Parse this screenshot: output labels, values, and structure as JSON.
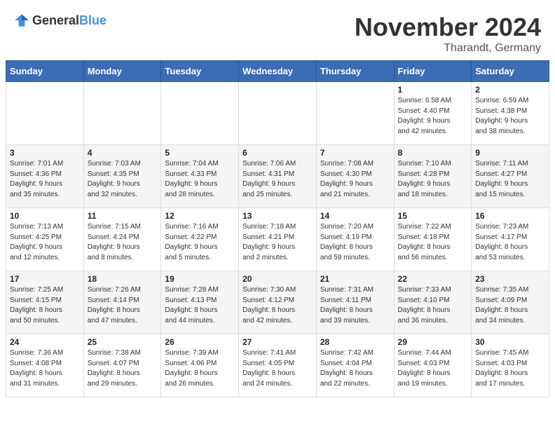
{
  "header": {
    "logo_general": "General",
    "logo_blue": "Blue",
    "month": "November 2024",
    "location": "Tharandt, Germany"
  },
  "weekdays": [
    "Sunday",
    "Monday",
    "Tuesday",
    "Wednesday",
    "Thursday",
    "Friday",
    "Saturday"
  ],
  "weeks": [
    [
      {
        "day": "",
        "info": ""
      },
      {
        "day": "",
        "info": ""
      },
      {
        "day": "",
        "info": ""
      },
      {
        "day": "",
        "info": ""
      },
      {
        "day": "",
        "info": ""
      },
      {
        "day": "1",
        "info": "Sunrise: 6:58 AM\nSunset: 4:40 PM\nDaylight: 9 hours\nand 42 minutes."
      },
      {
        "day": "2",
        "info": "Sunrise: 6:59 AM\nSunset: 4:38 PM\nDaylight: 9 hours\nand 38 minutes."
      }
    ],
    [
      {
        "day": "3",
        "info": "Sunrise: 7:01 AM\nSunset: 4:36 PM\nDaylight: 9 hours\nand 35 minutes."
      },
      {
        "day": "4",
        "info": "Sunrise: 7:03 AM\nSunset: 4:35 PM\nDaylight: 9 hours\nand 32 minutes."
      },
      {
        "day": "5",
        "info": "Sunrise: 7:04 AM\nSunset: 4:33 PM\nDaylight: 9 hours\nand 28 minutes."
      },
      {
        "day": "6",
        "info": "Sunrise: 7:06 AM\nSunset: 4:31 PM\nDaylight: 9 hours\nand 25 minutes."
      },
      {
        "day": "7",
        "info": "Sunrise: 7:08 AM\nSunset: 4:30 PM\nDaylight: 9 hours\nand 21 minutes."
      },
      {
        "day": "8",
        "info": "Sunrise: 7:10 AM\nSunset: 4:28 PM\nDaylight: 9 hours\nand 18 minutes."
      },
      {
        "day": "9",
        "info": "Sunrise: 7:11 AM\nSunset: 4:27 PM\nDaylight: 9 hours\nand 15 minutes."
      }
    ],
    [
      {
        "day": "10",
        "info": "Sunrise: 7:13 AM\nSunset: 4:25 PM\nDaylight: 9 hours\nand 12 minutes."
      },
      {
        "day": "11",
        "info": "Sunrise: 7:15 AM\nSunset: 4:24 PM\nDaylight: 9 hours\nand 8 minutes."
      },
      {
        "day": "12",
        "info": "Sunrise: 7:16 AM\nSunset: 4:22 PM\nDaylight: 9 hours\nand 5 minutes."
      },
      {
        "day": "13",
        "info": "Sunrise: 7:18 AM\nSunset: 4:21 PM\nDaylight: 9 hours\nand 2 minutes."
      },
      {
        "day": "14",
        "info": "Sunrise: 7:20 AM\nSunset: 4:19 PM\nDaylight: 8 hours\nand 59 minutes."
      },
      {
        "day": "15",
        "info": "Sunrise: 7:22 AM\nSunset: 4:18 PM\nDaylight: 8 hours\nand 56 minutes."
      },
      {
        "day": "16",
        "info": "Sunrise: 7:23 AM\nSunset: 4:17 PM\nDaylight: 8 hours\nand 53 minutes."
      }
    ],
    [
      {
        "day": "17",
        "info": "Sunrise: 7:25 AM\nSunset: 4:15 PM\nDaylight: 8 hours\nand 50 minutes."
      },
      {
        "day": "18",
        "info": "Sunrise: 7:26 AM\nSunset: 4:14 PM\nDaylight: 8 hours\nand 47 minutes."
      },
      {
        "day": "19",
        "info": "Sunrise: 7:28 AM\nSunset: 4:13 PM\nDaylight: 8 hours\nand 44 minutes."
      },
      {
        "day": "20",
        "info": "Sunrise: 7:30 AM\nSunset: 4:12 PM\nDaylight: 8 hours\nand 42 minutes."
      },
      {
        "day": "21",
        "info": "Sunrise: 7:31 AM\nSunset: 4:11 PM\nDaylight: 8 hours\nand 39 minutes."
      },
      {
        "day": "22",
        "info": "Sunrise: 7:33 AM\nSunset: 4:10 PM\nDaylight: 8 hours\nand 36 minutes."
      },
      {
        "day": "23",
        "info": "Sunrise: 7:35 AM\nSunset: 4:09 PM\nDaylight: 8 hours\nand 34 minutes."
      }
    ],
    [
      {
        "day": "24",
        "info": "Sunrise: 7:36 AM\nSunset: 4:08 PM\nDaylight: 8 hours\nand 31 minutes."
      },
      {
        "day": "25",
        "info": "Sunrise: 7:38 AM\nSunset: 4:07 PM\nDaylight: 8 hours\nand 29 minutes."
      },
      {
        "day": "26",
        "info": "Sunrise: 7:39 AM\nSunset: 4:06 PM\nDaylight: 8 hours\nand 26 minutes."
      },
      {
        "day": "27",
        "info": "Sunrise: 7:41 AM\nSunset: 4:05 PM\nDaylight: 8 hours\nand 24 minutes."
      },
      {
        "day": "28",
        "info": "Sunrise: 7:42 AM\nSunset: 4:04 PM\nDaylight: 8 hours\nand 22 minutes."
      },
      {
        "day": "29",
        "info": "Sunrise: 7:44 AM\nSunset: 4:03 PM\nDaylight: 8 hours\nand 19 minutes."
      },
      {
        "day": "30",
        "info": "Sunrise: 7:45 AM\nSunset: 4:03 PM\nDaylight: 8 hours\nand 17 minutes."
      }
    ]
  ]
}
